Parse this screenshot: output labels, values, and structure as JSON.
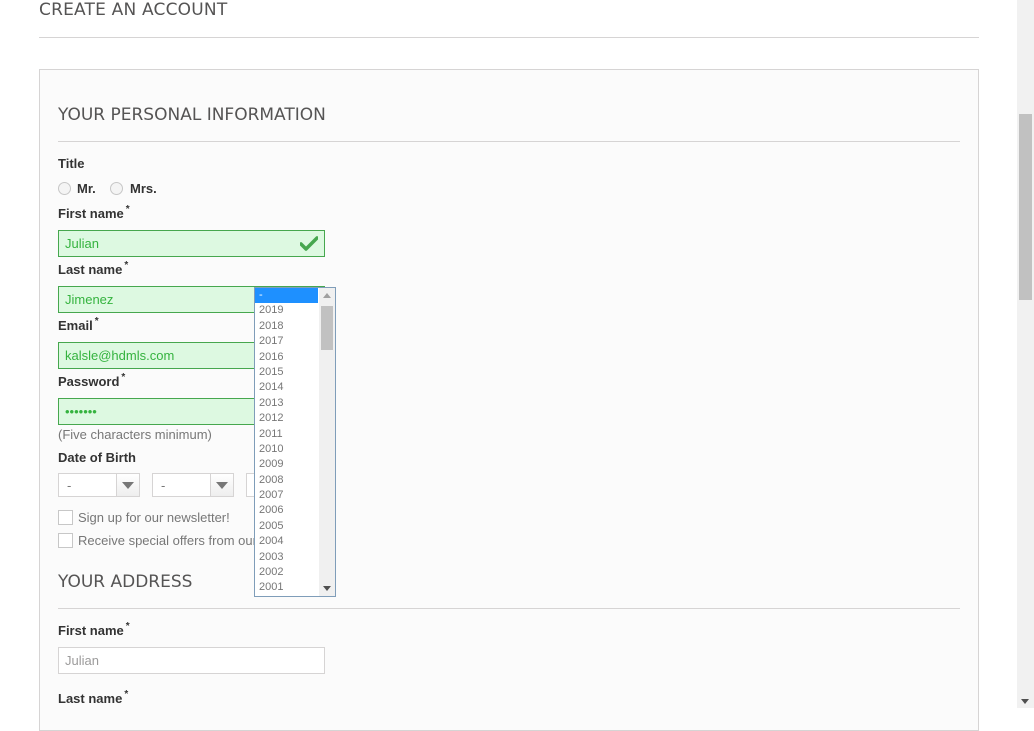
{
  "page": {
    "heading": "CREATE AN ACCOUNT"
  },
  "personal": {
    "section_title": "YOUR PERSONAL INFORMATION",
    "title_label": "Title",
    "title_options": [
      "Mr.",
      "Mrs."
    ],
    "first_name_label": "First name",
    "first_name_value": "Julian",
    "last_name_label": "Last name",
    "last_name_value": "Jimenez",
    "email_label": "Email",
    "email_value": "kalsle@hdmls.com",
    "password_label": "Password",
    "password_value": "•••••••",
    "password_hint": "(Five characters minimum)",
    "dob_label": "Date of Birth",
    "dob_day": "-",
    "dob_month": "-",
    "newsletter_label": "Sign up for our newsletter!",
    "offers_label": "Receive special offers from our partners!",
    "required_mark": "*"
  },
  "year_dropdown": {
    "options": [
      "-",
      "2019",
      "2018",
      "2017",
      "2016",
      "2015",
      "2014",
      "2013",
      "2012",
      "2011",
      "2010",
      "2009",
      "2008",
      "2007",
      "2006",
      "2005",
      "2004",
      "2003",
      "2002",
      "2001"
    ],
    "selected": "-"
  },
  "address": {
    "section_title": "YOUR ADDRESS",
    "first_name_label": "First name",
    "first_name_value": "Julian",
    "last_name_label": "Last name"
  },
  "colors": {
    "valid_border": "#46a74e",
    "valid_bg": "#ddf9e1",
    "valid_text": "#35b33f",
    "dropdown_highlight": "#1e90ff"
  },
  "icons": {
    "valid": "check-icon"
  }
}
